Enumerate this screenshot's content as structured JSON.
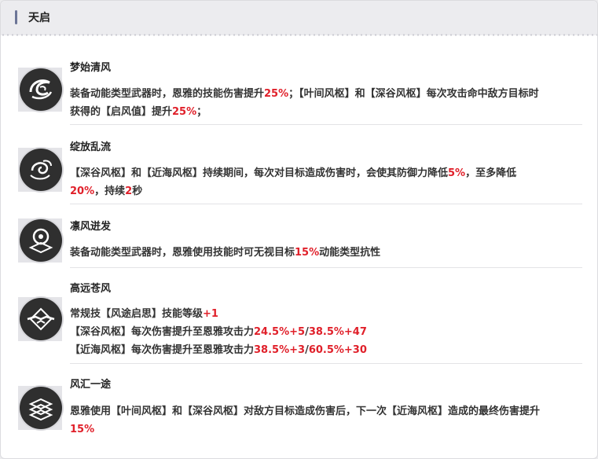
{
  "header": {
    "title": "天启"
  },
  "items": [
    {
      "name": "梦始清风",
      "lines": [
        [
          {
            "t": "装备动能类型武器时，恩雅的技能伤害提升"
          },
          {
            "t": "25%",
            "h": true
          },
          {
            "t": "；【叶间风枢】和【深谷风枢】每次攻击命中敌方目标时"
          }
        ],
        [
          {
            "t": "获得的【启风值】提升"
          },
          {
            "t": "25%",
            "h": true
          },
          {
            "t": "；"
          }
        ]
      ]
    },
    {
      "name": "绽放乱流",
      "lines": [
        [
          {
            "t": "【深谷风枢】和【近海风枢】持续期间，每次对目标造成伤害时，会使其防御力降低"
          },
          {
            "t": "5%",
            "h": true
          },
          {
            "t": "，至多降低"
          }
        ],
        [
          {
            "t": "20%",
            "h": true
          },
          {
            "t": "，持续"
          },
          {
            "t": "2",
            "h": true
          },
          {
            "t": "秒"
          }
        ]
      ]
    },
    {
      "name": "凛风迸发",
      "lines": [
        [
          {
            "t": "装备动能类型武器时，恩雅使用技能时可无视目标"
          },
          {
            "t": "15%",
            "h": true
          },
          {
            "t": "动能类型抗性"
          }
        ]
      ]
    },
    {
      "name": "高远苍风",
      "lines": [
        [
          {
            "t": "常规技【风途启思】技能等级"
          },
          {
            "t": "+1",
            "h": true
          }
        ],
        [
          {
            "t": "【深谷风枢】每次伤害提升至恩雅攻击力"
          },
          {
            "t": "24.5%+5",
            "h": true
          },
          {
            "t": "/"
          },
          {
            "t": "38.5%+47",
            "h": true
          }
        ],
        [
          {
            "t": "【近海风枢】每次伤害提升至恩雅攻击力"
          },
          {
            "t": "38.5%+3",
            "h": true
          },
          {
            "t": "/"
          },
          {
            "t": "60.5%+30",
            "h": true
          }
        ]
      ]
    },
    {
      "name": "风汇一途",
      "lines": [
        [
          {
            "t": "恩雅使用【叶间风枢】和【深谷风枢】对敌方目标造成伤害后，下一次【近海风枢】造成的最终伤害提升"
          }
        ],
        [
          {
            "t": "15%",
            "h": true
          }
        ]
      ]
    }
  ],
  "colors": {
    "highlight": "#e0202a",
    "accent_bar": "#6c7597"
  },
  "icons": [
    "swirl-emblem-icon",
    "spiral-emblem-icon",
    "orb-emblem-icon",
    "wing-emblem-icon",
    "layered-wind-emblem-icon"
  ]
}
